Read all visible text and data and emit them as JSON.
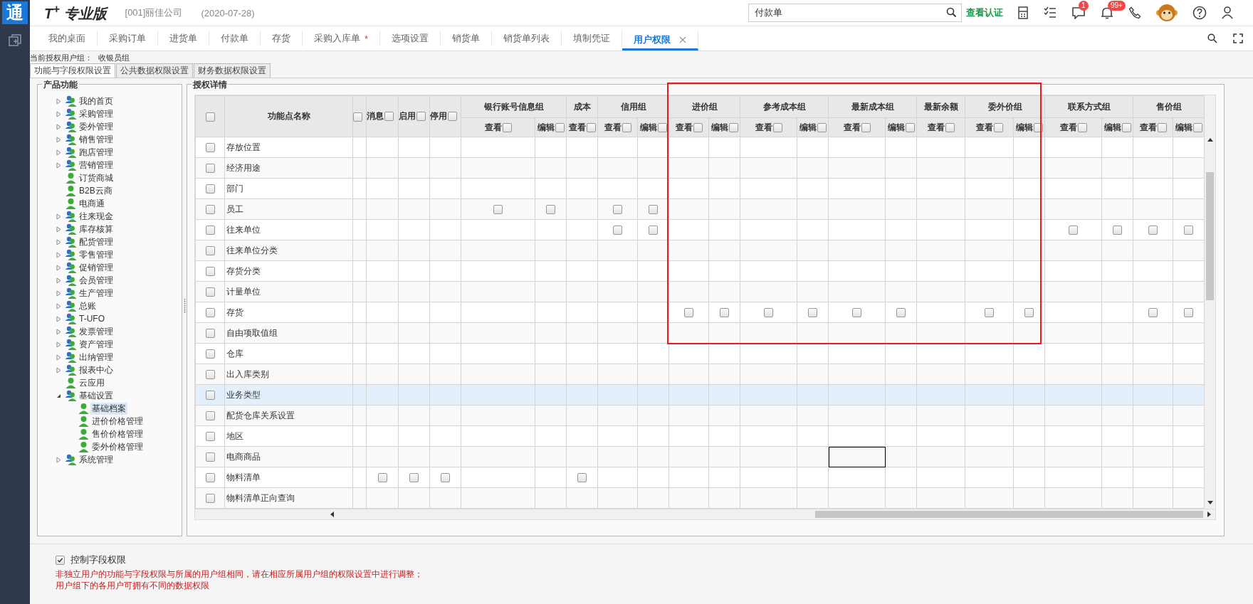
{
  "app": {
    "logo": "通",
    "product": "T$^{+}$ 专业版",
    "company": "[001]丽佳公司",
    "date": "(2020-07-28)",
    "search": {
      "value": "付款单"
    },
    "link": "查看认证",
    "badges": {
      "messages": "1",
      "notifications": "99+"
    }
  },
  "tabs": [
    {
      "label": "我的桌面",
      "selected": false
    },
    {
      "label": "采购订单",
      "selected": false
    },
    {
      "label": "进货单",
      "selected": false
    },
    {
      "label": "付款单",
      "selected": false
    },
    {
      "label": "存货",
      "selected": false
    },
    {
      "label": "采购入库单",
      "selected": false,
      "mark": "*"
    },
    {
      "label": "选项设置",
      "selected": false
    },
    {
      "label": "销货单",
      "selected": false
    },
    {
      "label": "销货单列表",
      "selected": false
    },
    {
      "label": "填制凭证",
      "selected": false
    },
    {
      "label": "用户权限",
      "selected": true
    }
  ],
  "user_group": {
    "label": "当前授权用户组：",
    "value": "收银员组"
  },
  "sub_tabs": [
    {
      "label": "功能与字段权限设置",
      "selected": true
    },
    {
      "label": "公共数据权限设置",
      "selected": false
    },
    {
      "label": "财务数据权限设置",
      "selected": false
    }
  ],
  "tree": {
    "title": "产品功能",
    "items": [
      {
        "label": "我的首页",
        "kind": "group",
        "expanded": false,
        "selected": false
      },
      {
        "label": "采购管理",
        "kind": "group",
        "expanded": false,
        "selected": false
      },
      {
        "label": "委外管理",
        "kind": "group",
        "expanded": false,
        "selected": false
      },
      {
        "label": "销售管理",
        "kind": "group",
        "expanded": false,
        "selected": false
      },
      {
        "label": "跑店管理",
        "kind": "group",
        "expanded": false,
        "selected": false
      },
      {
        "label": "营销管理",
        "kind": "group",
        "expanded": false,
        "selected": false
      },
      {
        "label": "订货商城",
        "kind": "user",
        "selected": false
      },
      {
        "label": "B2B云商",
        "kind": "user",
        "selected": false
      },
      {
        "label": "电商通",
        "kind": "user",
        "selected": false
      },
      {
        "label": "往来现金",
        "kind": "group",
        "expanded": false,
        "selected": false
      },
      {
        "label": "库存核算",
        "kind": "group",
        "expanded": false,
        "selected": false
      },
      {
        "label": "配货管理",
        "kind": "group",
        "expanded": false,
        "selected": false
      },
      {
        "label": "零售管理",
        "kind": "group",
        "expanded": false,
        "selected": false
      },
      {
        "label": "促销管理",
        "kind": "group",
        "expanded": false,
        "selected": false
      },
      {
        "label": "会员管理",
        "kind": "group",
        "expanded": false,
        "selected": false
      },
      {
        "label": "生产管理",
        "kind": "group",
        "expanded": false,
        "selected": false
      },
      {
        "label": "总账",
        "kind": "group",
        "expanded": false,
        "selected": false
      },
      {
        "label": "T-UFO",
        "kind": "group",
        "expanded": false,
        "selected": false
      },
      {
        "label": "发票管理",
        "kind": "group",
        "expanded": false,
        "selected": false
      },
      {
        "label": "资产管理",
        "kind": "group",
        "expanded": false,
        "selected": false
      },
      {
        "label": "出纳管理",
        "kind": "group",
        "expanded": false,
        "selected": false
      },
      {
        "label": "报表中心",
        "kind": "group",
        "expanded": false,
        "selected": false
      },
      {
        "label": "云应用",
        "kind": "user",
        "selected": false
      },
      {
        "label": "基础设置",
        "kind": "group",
        "expanded": true,
        "selected": false,
        "children": [
          {
            "label": "基础档案",
            "kind": "user",
            "selected": true
          },
          {
            "label": "进价价格管理",
            "kind": "user",
            "selected": false
          },
          {
            "label": "售价价格管理",
            "kind": "user",
            "selected": false
          },
          {
            "label": "委外价格管理",
            "kind": "user",
            "selected": false
          }
        ]
      },
      {
        "label": "系统管理",
        "kind": "group",
        "expanded": false,
        "selected": false
      }
    ]
  },
  "table": {
    "title": "授权详情",
    "select_all_checked": false,
    "name_column": "功能点名称",
    "flag_columns": [
      {
        "checked": false
      },
      {
        "label": "消息",
        "checked": false
      },
      {
        "label": "启用",
        "checked": false
      },
      {
        "label": "停用",
        "checked": false
      }
    ],
    "groups": [
      {
        "label": "银行账号信息组",
        "columns": [
          {
            "label": "查看",
            "checked": false
          },
          {
            "label": "编辑",
            "checked": false
          }
        ]
      },
      {
        "label": "成本",
        "columns": [
          {
            "label": "查看",
            "checked": false
          }
        ]
      },
      {
        "label": "信用组",
        "columns": [
          {
            "label": "查看",
            "checked": false
          },
          {
            "label": "编辑",
            "checked": false
          }
        ]
      },
      {
        "label": "进价组",
        "columns": [
          {
            "label": "查看",
            "checked": false
          },
          {
            "label": "编辑",
            "checked": false
          }
        ]
      },
      {
        "label": "参考成本组",
        "columns": [
          {
            "label": "查看",
            "checked": false
          },
          {
            "label": "编辑",
            "checked": false
          }
        ]
      },
      {
        "label": "最新成本组",
        "columns": [
          {
            "label": "查看",
            "checked": false
          },
          {
            "label": "编辑",
            "checked": false
          }
        ]
      },
      {
        "label": "最新余额",
        "columns": [
          {
            "label": "查看",
            "checked": false
          }
        ]
      },
      {
        "label": "委外价组",
        "columns": [
          {
            "label": "查看",
            "checked": false
          },
          {
            "label": "编辑",
            "checked": false
          }
        ]
      },
      {
        "label": "联系方式组",
        "columns": [
          {
            "label": "查看",
            "checked": false
          },
          {
            "label": "编辑",
            "checked": false
          }
        ]
      },
      {
        "label": "售价组",
        "columns": [
          {
            "label": "查看",
            "checked": false
          },
          {
            "label": "编辑",
            "checked": false
          }
        ]
      }
    ],
    "rows": [
      {
        "name": "存放位置",
        "checked": false,
        "selected": false,
        "cells": [
          null,
          null,
          null,
          null,
          null,
          null,
          null,
          null,
          null,
          null,
          null,
          null,
          null,
          null,
          null,
          null,
          null,
          null,
          null,
          null,
          null,
          null
        ]
      },
      {
        "name": "经济用途",
        "checked": false,
        "selected": false,
        "cells": [
          null,
          null,
          null,
          null,
          null,
          null,
          null,
          null,
          null,
          null,
          null,
          null,
          null,
          null,
          null,
          null,
          null,
          null,
          null,
          null,
          null,
          null
        ]
      },
      {
        "name": "部门",
        "checked": false,
        "selected": false,
        "cells": [
          null,
          null,
          null,
          null,
          null,
          null,
          null,
          null,
          null,
          null,
          null,
          null,
          null,
          null,
          null,
          null,
          null,
          null,
          null,
          null,
          null,
          null
        ]
      },
      {
        "name": "员工",
        "checked": false,
        "selected": false,
        "cells": [
          null,
          null,
          null,
          null,
          false,
          false,
          null,
          false,
          false,
          null,
          null,
          null,
          null,
          null,
          null,
          null,
          null,
          null,
          null,
          null,
          null,
          null
        ]
      },
      {
        "name": "往来单位",
        "checked": false,
        "selected": false,
        "cells": [
          null,
          null,
          null,
          null,
          null,
          null,
          null,
          false,
          false,
          null,
          null,
          null,
          null,
          null,
          null,
          null,
          null,
          null,
          false,
          false,
          false,
          false
        ]
      },
      {
        "name": "往来单位分类",
        "checked": false,
        "selected": false,
        "cells": [
          null,
          null,
          null,
          null,
          null,
          null,
          null,
          null,
          null,
          null,
          null,
          null,
          null,
          null,
          null,
          null,
          null,
          null,
          null,
          null,
          null,
          null
        ]
      },
      {
        "name": "存货分类",
        "checked": false,
        "selected": false,
        "cells": [
          null,
          null,
          null,
          null,
          null,
          null,
          null,
          null,
          null,
          null,
          null,
          null,
          null,
          null,
          null,
          null,
          null,
          null,
          null,
          null,
          null,
          null
        ]
      },
      {
        "name": "计量单位",
        "checked": false,
        "selected": false,
        "cells": [
          null,
          null,
          null,
          null,
          null,
          null,
          null,
          null,
          null,
          null,
          null,
          null,
          null,
          null,
          null,
          null,
          null,
          null,
          null,
          null,
          null,
          null
        ]
      },
      {
        "name": "存货",
        "checked": false,
        "selected": false,
        "cells": [
          null,
          null,
          null,
          null,
          null,
          null,
          null,
          null,
          null,
          false,
          false,
          false,
          false,
          false,
          false,
          null,
          false,
          false,
          null,
          null,
          false,
          false
        ]
      },
      {
        "name": "自由项取值组",
        "checked": false,
        "selected": false,
        "cells": [
          null,
          null,
          null,
          null,
          null,
          null,
          null,
          null,
          null,
          null,
          null,
          null,
          null,
          null,
          null,
          null,
          null,
          null,
          null,
          null,
          null,
          null
        ]
      },
      {
        "name": "仓库",
        "checked": false,
        "selected": false,
        "cells": [
          null,
          null,
          null,
          null,
          null,
          null,
          null,
          null,
          null,
          null,
          null,
          null,
          null,
          null,
          null,
          null,
          null,
          null,
          null,
          null,
          null,
          null
        ]
      },
      {
        "name": "出入库类别",
        "checked": false,
        "selected": false,
        "cells": [
          null,
          null,
          null,
          null,
          null,
          null,
          null,
          null,
          null,
          null,
          null,
          null,
          null,
          null,
          null,
          null,
          null,
          null,
          null,
          null,
          null,
          null
        ]
      },
      {
        "name": "业务类型",
        "checked": false,
        "selected": true,
        "cells": [
          null,
          null,
          null,
          null,
          null,
          null,
          null,
          null,
          null,
          null,
          null,
          null,
          null,
          null,
          null,
          null,
          null,
          null,
          null,
          null,
          null,
          null
        ]
      },
      {
        "name": "配货仓库关系设置",
        "checked": false,
        "selected": false,
        "cells": [
          null,
          null,
          null,
          null,
          null,
          null,
          null,
          null,
          null,
          null,
          null,
          null,
          null,
          null,
          null,
          null,
          null,
          null,
          null,
          null,
          null,
          null
        ]
      },
      {
        "name": "地区",
        "checked": false,
        "selected": false,
        "cells": [
          null,
          null,
          null,
          null,
          null,
          null,
          null,
          null,
          null,
          null,
          null,
          null,
          null,
          null,
          null,
          null,
          null,
          null,
          null,
          null,
          null,
          null
        ]
      },
      {
        "name": "电商商品",
        "checked": false,
        "selected": false,
        "cells": [
          null,
          null,
          null,
          null,
          null,
          null,
          null,
          null,
          null,
          null,
          null,
          null,
          null,
          {
            "focused": true
          },
          null,
          null,
          null,
          null,
          null,
          null,
          null,
          null
        ]
      },
      {
        "name": "物料清单",
        "checked": false,
        "selected": false,
        "cells": [
          null,
          false,
          false,
          false,
          null,
          null,
          false,
          null,
          null,
          null,
          null,
          null,
          null,
          null,
          null,
          null,
          null,
          null,
          null,
          null,
          null,
          null
        ]
      },
      {
        "name": "物料清单正向查询",
        "checked": false,
        "selected": false,
        "cells": [
          null,
          null,
          null,
          null,
          null,
          null,
          null,
          null,
          null,
          null,
          null,
          null,
          null,
          null,
          null,
          null,
          null,
          null,
          null,
          null,
          null,
          null
        ]
      }
    ]
  },
  "field_control": {
    "label": "控制字段权限",
    "checked": true
  },
  "notes": [
    "非独立用户的功能与字段权限与所属的用户组相同，请在相应所属用户组的权限设置中进行调整；",
    "用户组下的各用户可拥有不同的数据权限"
  ]
}
